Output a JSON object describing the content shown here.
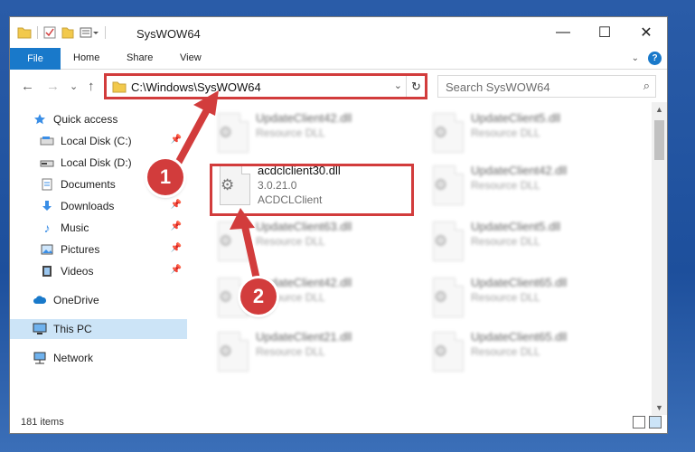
{
  "window": {
    "title": "SysWOW64",
    "controls": {
      "minimize": "—",
      "maximize": "☐",
      "close": "✕"
    }
  },
  "ribbon": {
    "tabs": [
      "File",
      "Home",
      "Share",
      "View"
    ]
  },
  "nav": {
    "back": "←",
    "forward": "→",
    "recent": "⌄",
    "up": "↑",
    "address": "C:\\Windows\\SysWOW64",
    "search_placeholder": "Search SysWOW64"
  },
  "sidebar": {
    "items": [
      {
        "label": "Quick access",
        "icon": "star-icon",
        "pinned": false
      },
      {
        "label": "Local Disk (C:)",
        "icon": "drive-icon",
        "pinned": true
      },
      {
        "label": "Local Disk (D:)",
        "icon": "drive-icon",
        "pinned": false
      },
      {
        "label": "Documents",
        "icon": "documents-icon",
        "pinned": true
      },
      {
        "label": "Downloads",
        "icon": "download-icon",
        "pinned": true
      },
      {
        "label": "Music",
        "icon": "music-icon",
        "pinned": true
      },
      {
        "label": "Pictures",
        "icon": "pictures-icon",
        "pinned": true
      },
      {
        "label": "Videos",
        "icon": "videos-icon",
        "pinned": true
      },
      {
        "label": "OneDrive",
        "icon": "cloud-icon",
        "pinned": false
      },
      {
        "label": "This PC",
        "icon": "computer-icon",
        "pinned": false,
        "selected": true
      },
      {
        "label": "Network",
        "icon": "network-icon",
        "pinned": false
      }
    ]
  },
  "files": [
    {
      "name": "UpdateClient42.dll",
      "line2": "Resource DLL",
      "line3": ""
    },
    {
      "name": "UpdateClient5.dll",
      "line2": "Resource DLL",
      "line3": ""
    },
    {
      "name": "acdclclient30.dll",
      "line2": "3.0.21.0",
      "line3": "ACDCLClient",
      "highlighted": true
    },
    {
      "name": "UpdateClient42.dll",
      "line2": "Resource DLL",
      "line3": ""
    },
    {
      "name": "UpdateClient63.dll",
      "line2": "Resource DLL",
      "line3": ""
    },
    {
      "name": "UpdateClient5.dll",
      "line2": "Resource DLL",
      "line3": ""
    },
    {
      "name": "UpdateClient42.dll",
      "line2": "Resource DLL",
      "line3": ""
    },
    {
      "name": "UpdateClient65.dll",
      "line2": "Resource DLL",
      "line3": ""
    },
    {
      "name": "UpdateClient21.dll",
      "line2": "Resource DLL",
      "line3": ""
    },
    {
      "name": "UpdateClient65.dll",
      "line2": "Resource DLL",
      "line3": ""
    }
  ],
  "status": {
    "item_count": "181 items"
  },
  "annotations": {
    "step1": "1",
    "step2": "2"
  },
  "colors": {
    "accent": "#1979ca",
    "highlight": "#d23c3c",
    "selection": "#cce4f7"
  }
}
